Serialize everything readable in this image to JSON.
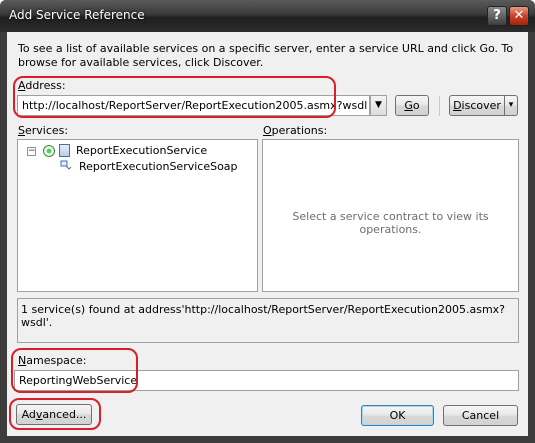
{
  "window": {
    "title": "Add Service Reference",
    "help_glyph": "?",
    "close_glyph": "✕"
  },
  "description": "To see a list of available services on a specific server, enter a service URL and click Go. To browse for available services, click Discover.",
  "address": {
    "label_prefix": "",
    "label_accel": "A",
    "label_rest": "ddress:",
    "value": "http://localhost/ReportServer/ReportExecution2005.asmx?wsdl",
    "dropdown_glyph": "▼",
    "go_accel": "G",
    "go_rest": "o",
    "discover_accel": "D",
    "discover_rest": "iscover",
    "discover_arrow": "▾"
  },
  "services": {
    "label_prefix": "",
    "label_accel": "S",
    "label_rest": "ervices:",
    "expander_glyph": "−",
    "items": [
      "ReportExecutionService",
      "ReportExecutionServiceSoap"
    ]
  },
  "operations": {
    "label_accel": "O",
    "label_rest": "perations:",
    "placeholder": "Select a service contract to view its operations."
  },
  "status_text": "1 service(s) found at address'http://localhost/ReportServer/ReportExecution2005.asmx?wsdl'.",
  "namespace": {
    "label_accel": "N",
    "label_rest": "amespace:",
    "value": "ReportingWebService"
  },
  "buttons": {
    "advanced_prefix": "Ad",
    "advanced_accel": "v",
    "advanced_rest": "anced...",
    "ok": "OK",
    "cancel": "Cancel"
  },
  "colors": {
    "highlight": "#d81f2a",
    "dialog_bg": "#f0f0f0"
  }
}
